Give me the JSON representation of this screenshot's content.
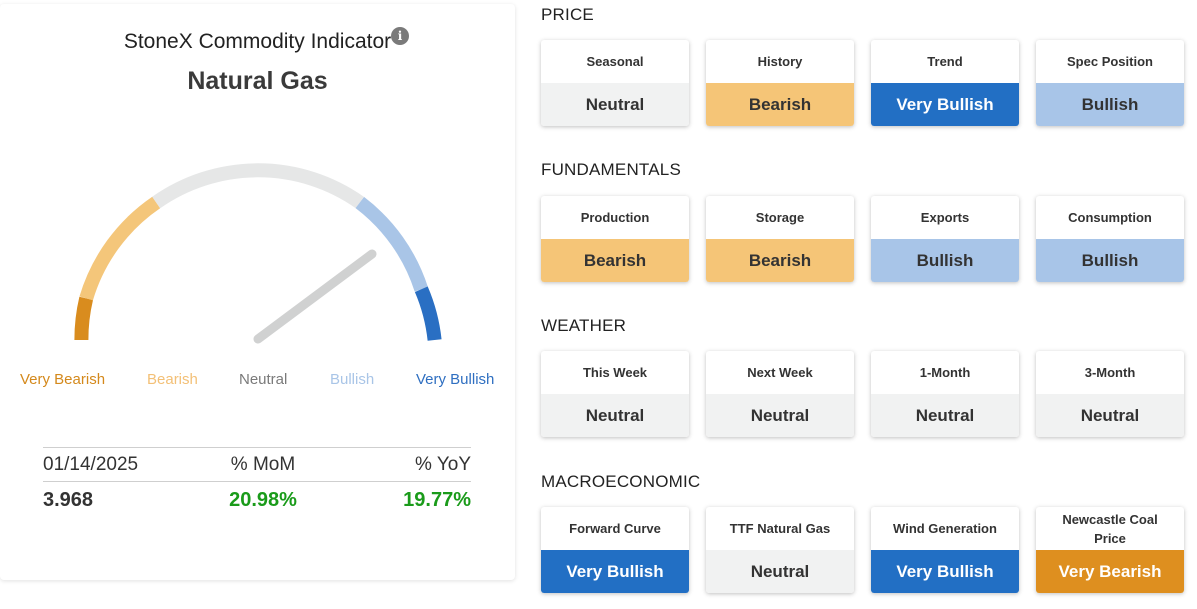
{
  "indicator": {
    "title": "StoneX Commodity Indicator",
    "info_icon": "info-circle-icon",
    "commodity": "Natural Gas",
    "gauge": {
      "labels": [
        "Very Bearish",
        "Bearish",
        "Neutral",
        "Bullish",
        "Very Bullish"
      ],
      "segment_colors": [
        "#d98c1e",
        "#f4c67a",
        "#e6e7e7",
        "#a9c5e7",
        "#2a6fc3"
      ],
      "needle_position": 0.64
    },
    "stats": {
      "date": "01/14/2025",
      "mom_label": "% MoM",
      "yoy_label": "% YoY",
      "price": "3.968",
      "mom": "20.98%",
      "yoy": "19.77%"
    }
  },
  "sections": [
    {
      "title": "PRICE",
      "tiles": [
        {
          "label": "Seasonal",
          "value": "Neutral"
        },
        {
          "label": "History",
          "value": "Bearish"
        },
        {
          "label": "Trend",
          "value": "Very Bullish"
        },
        {
          "label": "Spec Position",
          "value": "Bullish"
        }
      ]
    },
    {
      "title": "FUNDAMENTALS",
      "tiles": [
        {
          "label": "Production",
          "value": "Bearish"
        },
        {
          "label": "Storage",
          "value": "Bearish"
        },
        {
          "label": "Exports",
          "value": "Bullish"
        },
        {
          "label": "Consumption",
          "value": "Bullish"
        }
      ]
    },
    {
      "title": "WEATHER",
      "tiles": [
        {
          "label": "This Week",
          "value": "Neutral"
        },
        {
          "label": "Next Week",
          "value": "Neutral"
        },
        {
          "label": "1-Month",
          "value": "Neutral"
        },
        {
          "label": "3-Month",
          "value": "Neutral"
        }
      ]
    },
    {
      "title": "MACROECONOMIC",
      "tiles": [
        {
          "label": "Forward Curve",
          "value": "Very Bullish"
        },
        {
          "label": "TTF Natural Gas",
          "value": "Neutral"
        },
        {
          "label": "Wind Generation",
          "value": "Very Bullish"
        },
        {
          "label": "Newcastle Coal Price",
          "value": "Very Bearish"
        }
      ]
    }
  ],
  "sentiment_colors": {
    "Very Bearish": "#de8f1f",
    "Bearish": "#f5c577",
    "Neutral": "#f1f2f2",
    "Bullish": "#a8c5e8",
    "Very Bullish": "#226fc4"
  }
}
